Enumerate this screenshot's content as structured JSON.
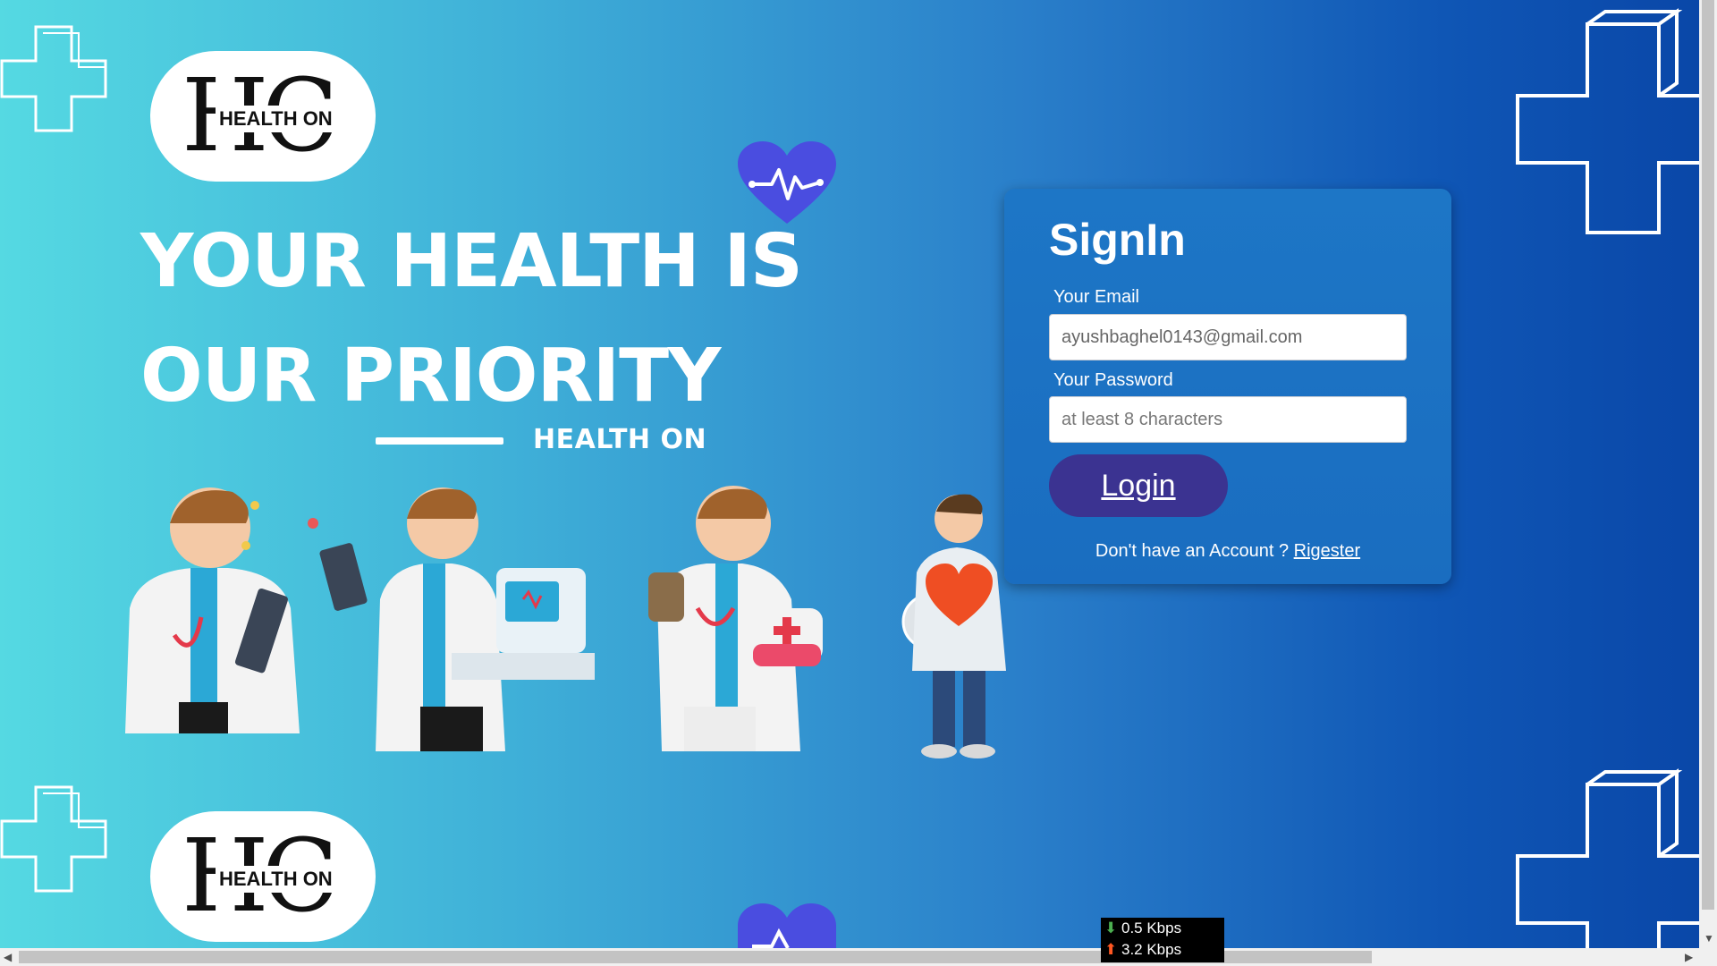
{
  "brand": {
    "logo_text": "HEALTH ON",
    "headline_line1": "YOUR HEALTH IS",
    "headline_line2": "OUR PRIORITY",
    "tagline": "HEALTH ON"
  },
  "signin": {
    "title": "SignIn",
    "email_label": "Your Email",
    "email_value": "ayushbaghel0143@gmail.com",
    "password_label": "Your Password",
    "password_placeholder": "at least 8 characters",
    "login_label": "Login",
    "no_account_text": "Don't have an Account ?",
    "register_link": "Rigester"
  },
  "net_monitor": {
    "download": "0.5 Kbps",
    "upload": "3.2 Kbps"
  },
  "colors": {
    "gradient_start": "#55d9e2",
    "gradient_end": "#0a47a8",
    "button": "#3b3391",
    "heart": "#4a4de0"
  },
  "icons": [
    "medical-cross-icon",
    "heart-pulse-icon",
    "doctor-illustration",
    "scroll-left-icon",
    "scroll-right-icon",
    "scroll-down-icon",
    "download-arrow-icon",
    "upload-arrow-icon"
  ]
}
